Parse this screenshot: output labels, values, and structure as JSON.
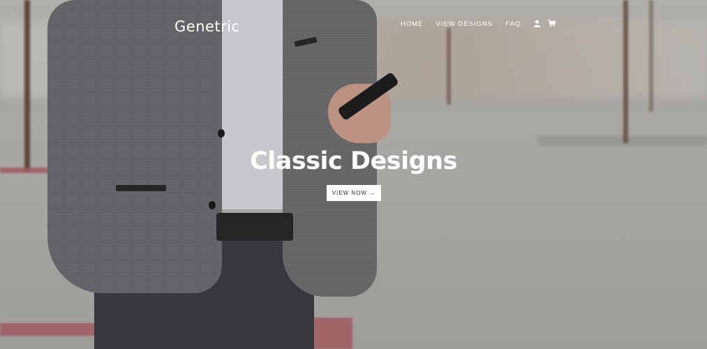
{
  "header": {
    "logo": "Genetric",
    "nav": [
      {
        "label": "HOME"
      },
      {
        "label": "VIEW DESIGNS"
      },
      {
        "label": "FAQ"
      }
    ],
    "icons": [
      "user-icon",
      "cart-icon"
    ]
  },
  "hero": {
    "title": "Classic Designs",
    "cta_label": "VIEW NOW →"
  },
  "colors": {
    "text_light": "#ffffff",
    "button_bg": "#ffffff",
    "button_text": "#333333"
  }
}
